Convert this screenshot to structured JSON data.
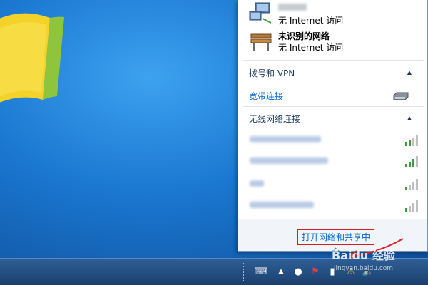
{
  "networks": [
    {
      "name": "",
      "status": "无 Internet 访问",
      "icon": "computer-network-icon"
    },
    {
      "name": "未识别的网络",
      "status": "无 Internet 访问",
      "icon": "bench-network-icon"
    }
  ],
  "dialup": {
    "heading": "拨号和 VPN",
    "connection_label": "宽带连接"
  },
  "wireless": {
    "heading": "无线网络连接",
    "count_rows": 4
  },
  "footer": {
    "open_center_label": "打开网络和共享中心"
  },
  "watermark": {
    "brand": "Baidu 经验",
    "sub": "jingyan.baidu.com"
  },
  "colors": {
    "link": "#0066cc",
    "heading": "#1e395b",
    "highlight_border": "#d02020",
    "taskbar": "#1b3f6d"
  }
}
